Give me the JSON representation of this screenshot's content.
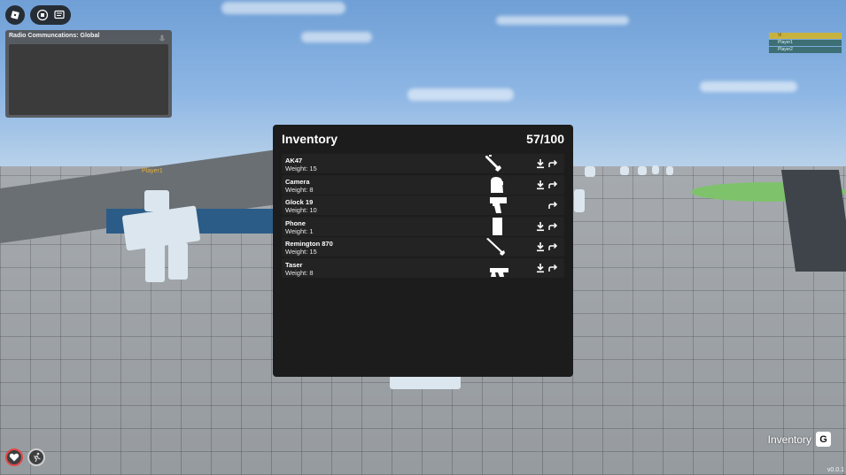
{
  "top_bar": {
    "menu_icon": "roblox-logo-icon",
    "scene_icon": "cube-scatter-icon",
    "chat_icon": "chat-bubble-icon"
  },
  "radio": {
    "title": "Radio Communcations: Global",
    "mic_icon": "microphone-icon"
  },
  "player_list": {
    "rows": [
      {
        "label": "Vi",
        "color": "#c8b23e"
      },
      {
        "label": "Player1",
        "color": "#3d6f75"
      },
      {
        "label": "Player2",
        "color": "#3d6f75"
      }
    ]
  },
  "name_tag": "Player1",
  "inventory": {
    "title": "Inventory",
    "count": "57/100",
    "items": [
      {
        "name": "AK47",
        "weight": "Weight: 15",
        "icon": "rifle-icon",
        "droppable": true
      },
      {
        "name": "Camera",
        "weight": "Weight: 8",
        "icon": "camera-icon",
        "droppable": true
      },
      {
        "name": "Glock 19",
        "weight": "Weight: 10",
        "icon": "pistol-icon",
        "droppable": false
      },
      {
        "name": "Phone",
        "weight": "Weight: 1",
        "icon": "phone-icon",
        "droppable": true
      },
      {
        "name": "Remington 870",
        "weight": "Weight: 15",
        "icon": "shotgun-icon",
        "droppable": true
      },
      {
        "name": "Taser",
        "weight": "Weight: 8",
        "icon": "taser-icon",
        "droppable": true
      }
    ]
  },
  "status_icons": {
    "health_icon": "heart-icon",
    "health_color": "#e34848",
    "stamina_icon": "running-icon"
  },
  "inventory_hint": {
    "label": "Inventory",
    "key": "G"
  },
  "version": "v0.0.1"
}
